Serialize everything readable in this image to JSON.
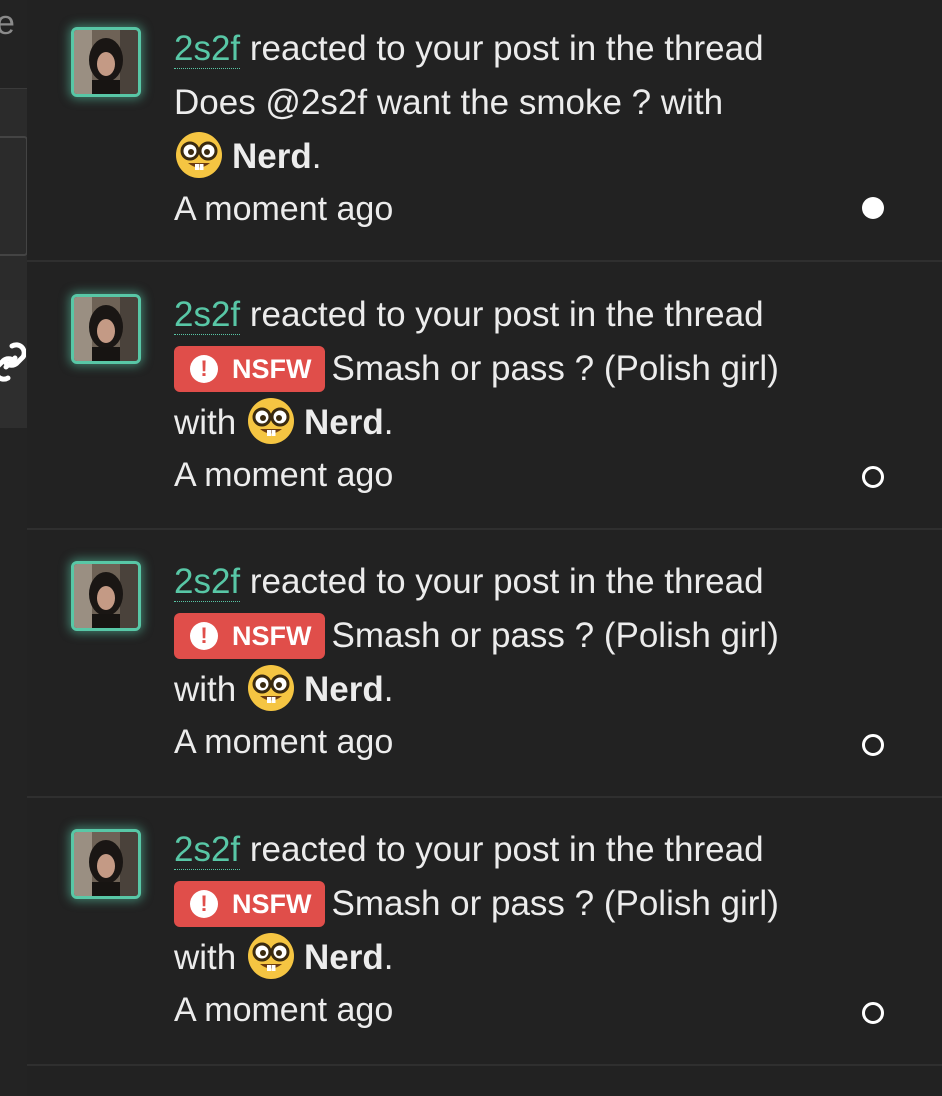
{
  "sidebar": {
    "fragment_text": "e",
    "link_icon": "link-icon"
  },
  "notifications": [
    {
      "username": "2s2f",
      "action_text": "reacted to your post in the thread",
      "prefix": "",
      "thread_title": "Does @2s2f want the smoke ? with",
      "with_text": "",
      "reaction_emoji": "nerd-face-emoji",
      "reaction_name": "Nerd",
      "punctuation": ".",
      "time": "A moment ago",
      "read_state": "unread"
    },
    {
      "username": "2s2f",
      "action_text": "reacted to your post in the thread",
      "prefix": "NSFW",
      "thread_title": "Smash or pass ? (Polish girl)",
      "with_text": "with",
      "reaction_emoji": "nerd-face-emoji",
      "reaction_name": "Nerd",
      "punctuation": ".",
      "time": "A moment ago",
      "read_state": "read"
    },
    {
      "username": "2s2f",
      "action_text": "reacted to your post in the thread",
      "prefix": "NSFW",
      "thread_title": "Smash or pass ? (Polish girl)",
      "with_text": "with",
      "reaction_emoji": "nerd-face-emoji",
      "reaction_name": "Nerd",
      "punctuation": ".",
      "time": "A moment ago",
      "read_state": "read"
    },
    {
      "username": "2s2f",
      "action_text": "reacted to your post in the thread",
      "prefix": "NSFW",
      "thread_title": "Smash or pass ? (Polish girl)",
      "with_text": "with",
      "reaction_emoji": "nerd-face-emoji",
      "reaction_name": "Nerd",
      "punctuation": ".",
      "time": "A moment ago",
      "read_state": "read"
    }
  ],
  "colors": {
    "panel_bg": "#222222",
    "username": "#58c7a6",
    "nsfw_badge": "#e04e4a",
    "text": "#ececec"
  }
}
